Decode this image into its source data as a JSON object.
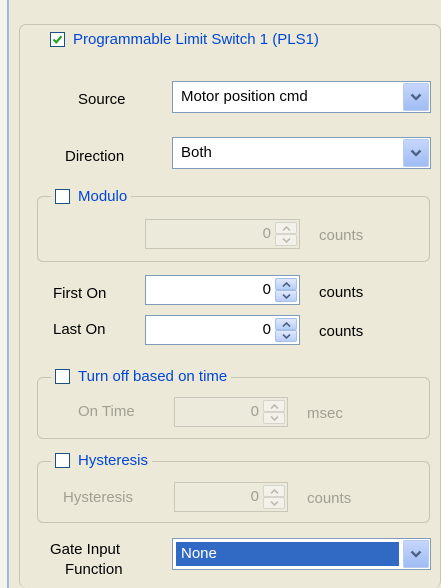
{
  "pls": {
    "title": "Programmable Limit Switch 1 (PLS1)",
    "enabled": true,
    "source": {
      "label": "Source",
      "value": "Motor position cmd"
    },
    "direction": {
      "label": "Direction",
      "value": "Both"
    },
    "modulo": {
      "label": "Modulo",
      "checked": false,
      "value": "0",
      "unit": "counts"
    },
    "first_on": {
      "label": "First On",
      "value": "0",
      "unit": "counts"
    },
    "last_on": {
      "label": "Last On",
      "value": "0",
      "unit": "counts"
    },
    "turn_off": {
      "label": "Turn off based on time",
      "checked": false,
      "field_label": "On Time",
      "value": "0",
      "unit": "msec"
    },
    "hysteresis": {
      "label": "Hysteresis",
      "checked": false,
      "field_label": "Hysteresis",
      "value": "0",
      "unit": "counts"
    },
    "gate_input": {
      "label_line1": "Gate Input",
      "label_line2": "Function",
      "value": "None"
    }
  },
  "colors": {
    "accent": "#0046d5",
    "selection": "#316ac5",
    "window_bg": "#ece9d8"
  }
}
